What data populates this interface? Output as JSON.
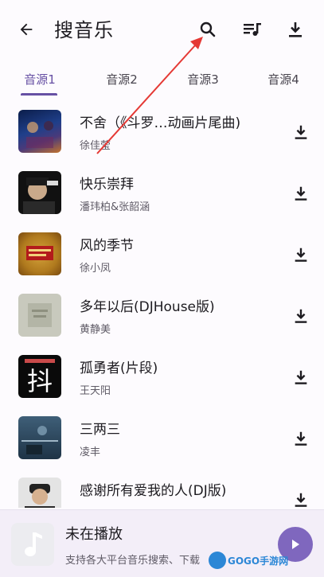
{
  "header": {
    "title": "搜音乐"
  },
  "tabs": [
    {
      "label": "音源1",
      "active": true
    },
    {
      "label": "音源2",
      "active": false
    },
    {
      "label": "音源3",
      "active": false
    },
    {
      "label": "音源4",
      "active": false
    }
  ],
  "songs": [
    {
      "title": "不舍（《斗罗…动画片尾曲)",
      "artist": "徐佳莹"
    },
    {
      "title": "快乐崇拜",
      "artist": "潘玮柏&张韶涵"
    },
    {
      "title": "风的季节",
      "artist": "徐小凤"
    },
    {
      "title": "多年以后(DJHouse版)",
      "artist": "黄静美"
    },
    {
      "title": "孤勇者(片段)",
      "artist": "王天阳"
    },
    {
      "title": "三两三",
      "artist": "凌丰"
    },
    {
      "title": "感谢所有爱我的人(DJ版)",
      "artist": ""
    }
  ],
  "player": {
    "title": "未在播放",
    "subtitle": "支持各大平台音乐搜索、下载"
  },
  "watermark": {
    "text": "GOGO手游网"
  },
  "colors": {
    "accent": "#6750a4",
    "annotation": "#e53935",
    "play_button": "#7f67be"
  }
}
